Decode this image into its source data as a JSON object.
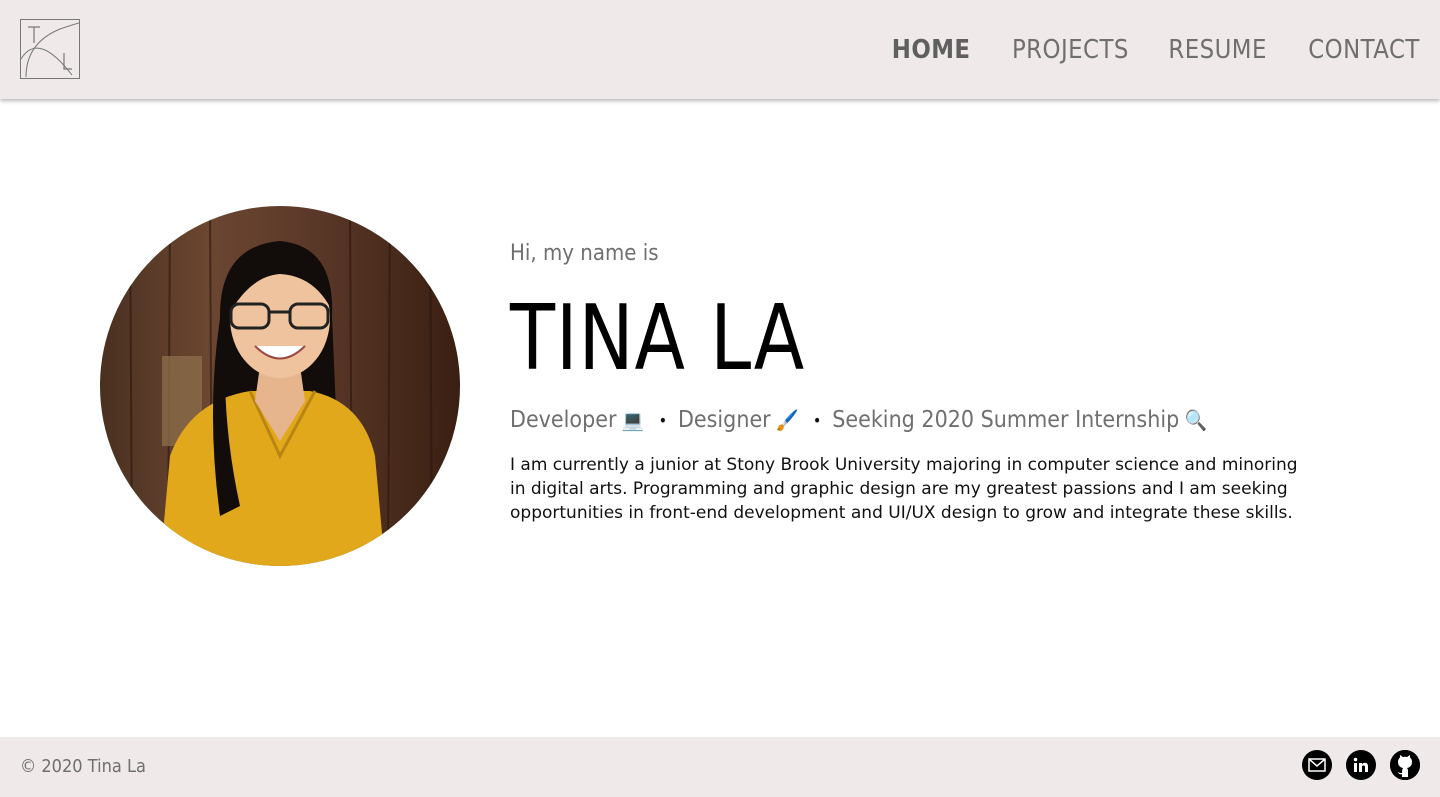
{
  "header": {
    "logo_letters": "T L",
    "nav": [
      {
        "label": "HOME",
        "active": true
      },
      {
        "label": "PROJECTS",
        "active": false
      },
      {
        "label": "RESUME",
        "active": false
      },
      {
        "label": "CONTACT",
        "active": false
      }
    ]
  },
  "hero": {
    "greeting": "Hi, my name is",
    "name": "TINA LA",
    "roles": [
      {
        "label": "Developer",
        "emoji": "💻"
      },
      {
        "label": "Designer",
        "emoji": "🖌️"
      },
      {
        "label": "Seeking 2020 Summer Internship",
        "emoji": "🔍"
      }
    ],
    "separator": "•",
    "bio": "I am currently a junior at Stony Brook University majoring in computer science and minoring in digital arts. Programming and graphic design are my greatest passions and I am seeking opportunities in front-end development and UI/UX design to grow and integrate these skills."
  },
  "footer": {
    "copyright": "© 2020 Tina La",
    "social": [
      {
        "icon": "mail-icon"
      },
      {
        "icon": "linkedin-icon"
      },
      {
        "icon": "github-icon"
      }
    ]
  },
  "colors": {
    "header_bg": "#efe9e9",
    "nav_text": "#6f6f6f",
    "sweater": "#e2a81c",
    "wood": "#5a3a26"
  }
}
